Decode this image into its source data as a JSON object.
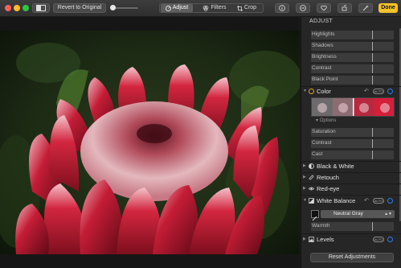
{
  "toolbar": {
    "revert_label": "Revert to Original",
    "tabs": [
      {
        "label": "Adjust",
        "icon": "dial-icon"
      },
      {
        "label": "Filters",
        "icon": "filters-icon"
      },
      {
        "label": "Crop",
        "icon": "crop-icon"
      }
    ],
    "active_tab": "Adjust",
    "done_label": "Done",
    "accent": "#f4c12a"
  },
  "panel": {
    "title": "ADJUST",
    "light_subs": [
      "Highlights",
      "Shadows",
      "Brightness",
      "Contrast",
      "Black Point"
    ],
    "color": {
      "label": "Color",
      "auto_label": "AUTO",
      "options_label": "Options",
      "subs": [
        "Saturation",
        "Contrast",
        "Cast"
      ]
    },
    "sections": {
      "bw": "Black & White",
      "retouch": "Retouch",
      "redeye": "Red-eye",
      "wb": "White Balance",
      "wb_auto": "AUTO",
      "wb_mode": "Neutral Gray",
      "wb_sub": "Warmth",
      "levels": "Levels",
      "levels_auto": "AUTO"
    },
    "reset_label": "Reset Adjustments"
  }
}
